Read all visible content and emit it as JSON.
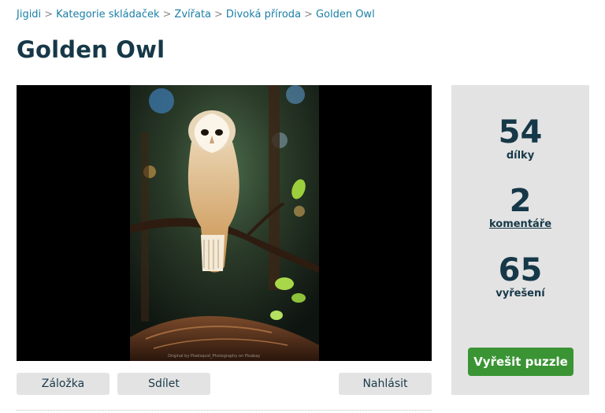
{
  "breadcrumb": {
    "items": [
      "Jigidi",
      "Kategorie skládaček",
      "Zvířata",
      "Divoká příroda",
      "Golden Owl"
    ],
    "separator": ">"
  },
  "page_title": "Golden Owl",
  "image": {
    "subject": "barn owl perched on a branch",
    "credit": "Original by Pixelsquid_Photography on Pixabay"
  },
  "actions": {
    "bookmark": "Záložka",
    "share": "Sdílet",
    "report": "Nahlásit"
  },
  "stats": {
    "pieces": {
      "value": "54",
      "label": "dílky"
    },
    "comments": {
      "value": "2",
      "label": "komentáře"
    },
    "solves": {
      "value": "65",
      "label": "vyřešení"
    }
  },
  "solve_button": "Vyřešit puzzle",
  "colors": {
    "link": "#1a7fa6",
    "title": "#163848",
    "panel_bg": "#e3e3e3",
    "solve_button_bg": "#3a9434"
  }
}
